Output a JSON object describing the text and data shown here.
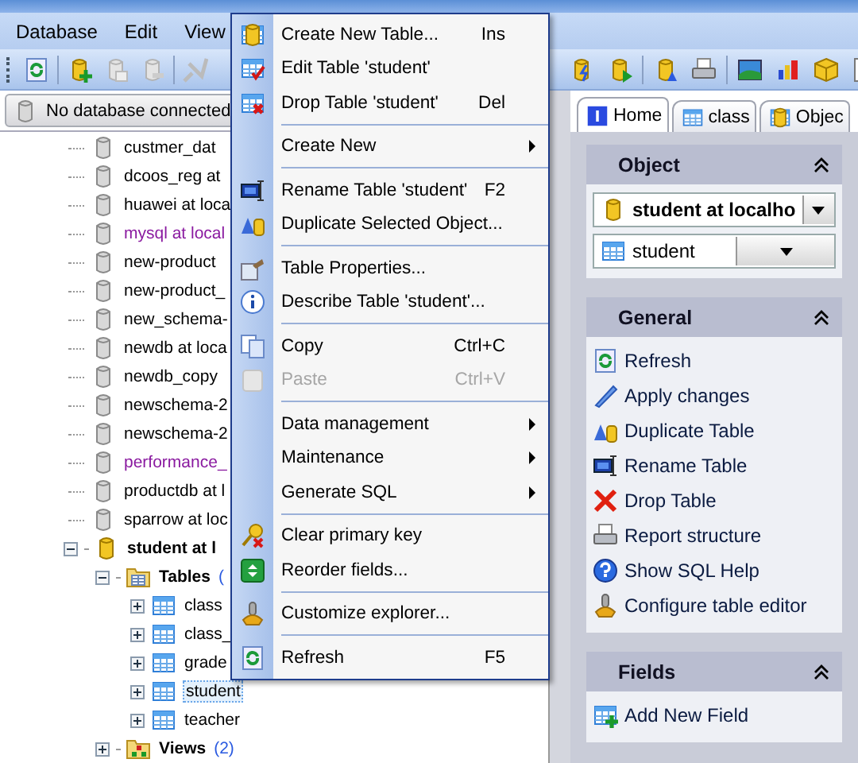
{
  "menubar": [
    {
      "label": "Database"
    },
    {
      "label": "Edit"
    },
    {
      "label": "View"
    }
  ],
  "toolbar": {
    "left": [
      {
        "disabled": false
      },
      {
        "disabled": false
      },
      {
        "disabled": true
      },
      {
        "disabled": true
      },
      {
        "disabled": true
      }
    ]
  },
  "connection_bar": {
    "text": "No database connected"
  },
  "tree": {
    "databases": [
      {
        "label": "custmer_dat",
        "system": false,
        "connected": false
      },
      {
        "label": "dcoos_reg at",
        "system": false,
        "connected": false
      },
      {
        "label": "huawei at loca",
        "system": false,
        "connected": false
      },
      {
        "label": "mysql at local",
        "system": true,
        "connected": false
      },
      {
        "label": "new-product",
        "system": false,
        "connected": false
      },
      {
        "label": "new-product_",
        "system": false,
        "connected": false
      },
      {
        "label": "new_schema-",
        "system": false,
        "connected": false
      },
      {
        "label": "newdb at loca",
        "system": false,
        "connected": false
      },
      {
        "label": "newdb_copy",
        "system": false,
        "connected": false
      },
      {
        "label": "newschema-2",
        "system": false,
        "connected": false
      },
      {
        "label": "newschema-2",
        "system": false,
        "connected": false
      },
      {
        "label": "performance_",
        "system": true,
        "connected": false
      },
      {
        "label": "productdb at l",
        "system": false,
        "connected": false
      },
      {
        "label": "sparrow at loc",
        "system": false,
        "connected": false
      },
      {
        "label": "student at l",
        "system": false,
        "connected": true,
        "expanded": true,
        "children": [
          {
            "label": "Tables",
            "count": "(",
            "kind": "tables",
            "expanded": true,
            "children": [
              {
                "label": "class",
                "selected": false
              },
              {
                "label": "class_",
                "selected": false
              },
              {
                "label": "grade",
                "selected": false
              },
              {
                "label": "student",
                "selected": true
              },
              {
                "label": "teacher",
                "selected": false
              }
            ]
          },
          {
            "label": "Views",
            "count": "(2)",
            "kind": "views",
            "expanded": false
          }
        ]
      }
    ]
  },
  "context_menu": [
    {
      "kind": "item",
      "label": "Create New Table...",
      "shortcut": "Ins",
      "disabled": false
    },
    {
      "kind": "item",
      "label": "Edit Table 'student'",
      "disabled": false
    },
    {
      "kind": "item",
      "label": "Drop Table 'student'",
      "shortcut": "Del",
      "disabled": false
    },
    {
      "kind": "separator"
    },
    {
      "kind": "submenu",
      "label": "Create New",
      "disabled": false
    },
    {
      "kind": "separator"
    },
    {
      "kind": "item",
      "label": "Rename Table 'student'",
      "shortcut": "F2",
      "disabled": false
    },
    {
      "kind": "item",
      "label": "Duplicate Selected Object...",
      "disabled": false
    },
    {
      "kind": "separator"
    },
    {
      "kind": "item",
      "label": "Table Properties...",
      "disabled": false
    },
    {
      "kind": "item",
      "label": "Describe Table 'student'...",
      "disabled": false
    },
    {
      "kind": "separator"
    },
    {
      "kind": "item",
      "label": "Copy",
      "shortcut": "Ctrl+C",
      "disabled": false
    },
    {
      "kind": "item",
      "label": "Paste",
      "shortcut": "Ctrl+V",
      "disabled": true
    },
    {
      "kind": "separator"
    },
    {
      "kind": "submenu",
      "label": "Data management",
      "disabled": false
    },
    {
      "kind": "submenu",
      "label": "Maintenance",
      "disabled": false
    },
    {
      "kind": "submenu",
      "label": "Generate SQL",
      "disabled": false
    },
    {
      "kind": "separator"
    },
    {
      "kind": "item",
      "label": "Clear primary key",
      "disabled": false
    },
    {
      "kind": "item",
      "label": "Reorder fields...",
      "disabled": false
    },
    {
      "kind": "separator"
    },
    {
      "kind": "item",
      "label": "Customize explorer...",
      "disabled": false
    },
    {
      "kind": "separator"
    },
    {
      "kind": "item",
      "label": "Refresh",
      "shortcut": "F5",
      "disabled": false
    }
  ],
  "tabs": [
    {
      "label": "Home",
      "selected": true
    },
    {
      "label": "class",
      "selected": false
    },
    {
      "label": "Objec",
      "selected": false
    }
  ],
  "object_panel": {
    "title": "Object",
    "database": "student at localho",
    "table": "student"
  },
  "general_panel": {
    "title": "General",
    "actions": [
      {
        "label": "Refresh"
      },
      {
        "label": "Apply changes"
      },
      {
        "label": "Duplicate Table"
      },
      {
        "label": "Rename Table"
      },
      {
        "label": "Drop Table"
      },
      {
        "label": "Report structure"
      },
      {
        "label": "Show SQL Help"
      },
      {
        "label": "Configure table editor"
      }
    ]
  },
  "fields_panel": {
    "title": "Fields",
    "actions": [
      {
        "label": "Add New Field"
      }
    ]
  }
}
